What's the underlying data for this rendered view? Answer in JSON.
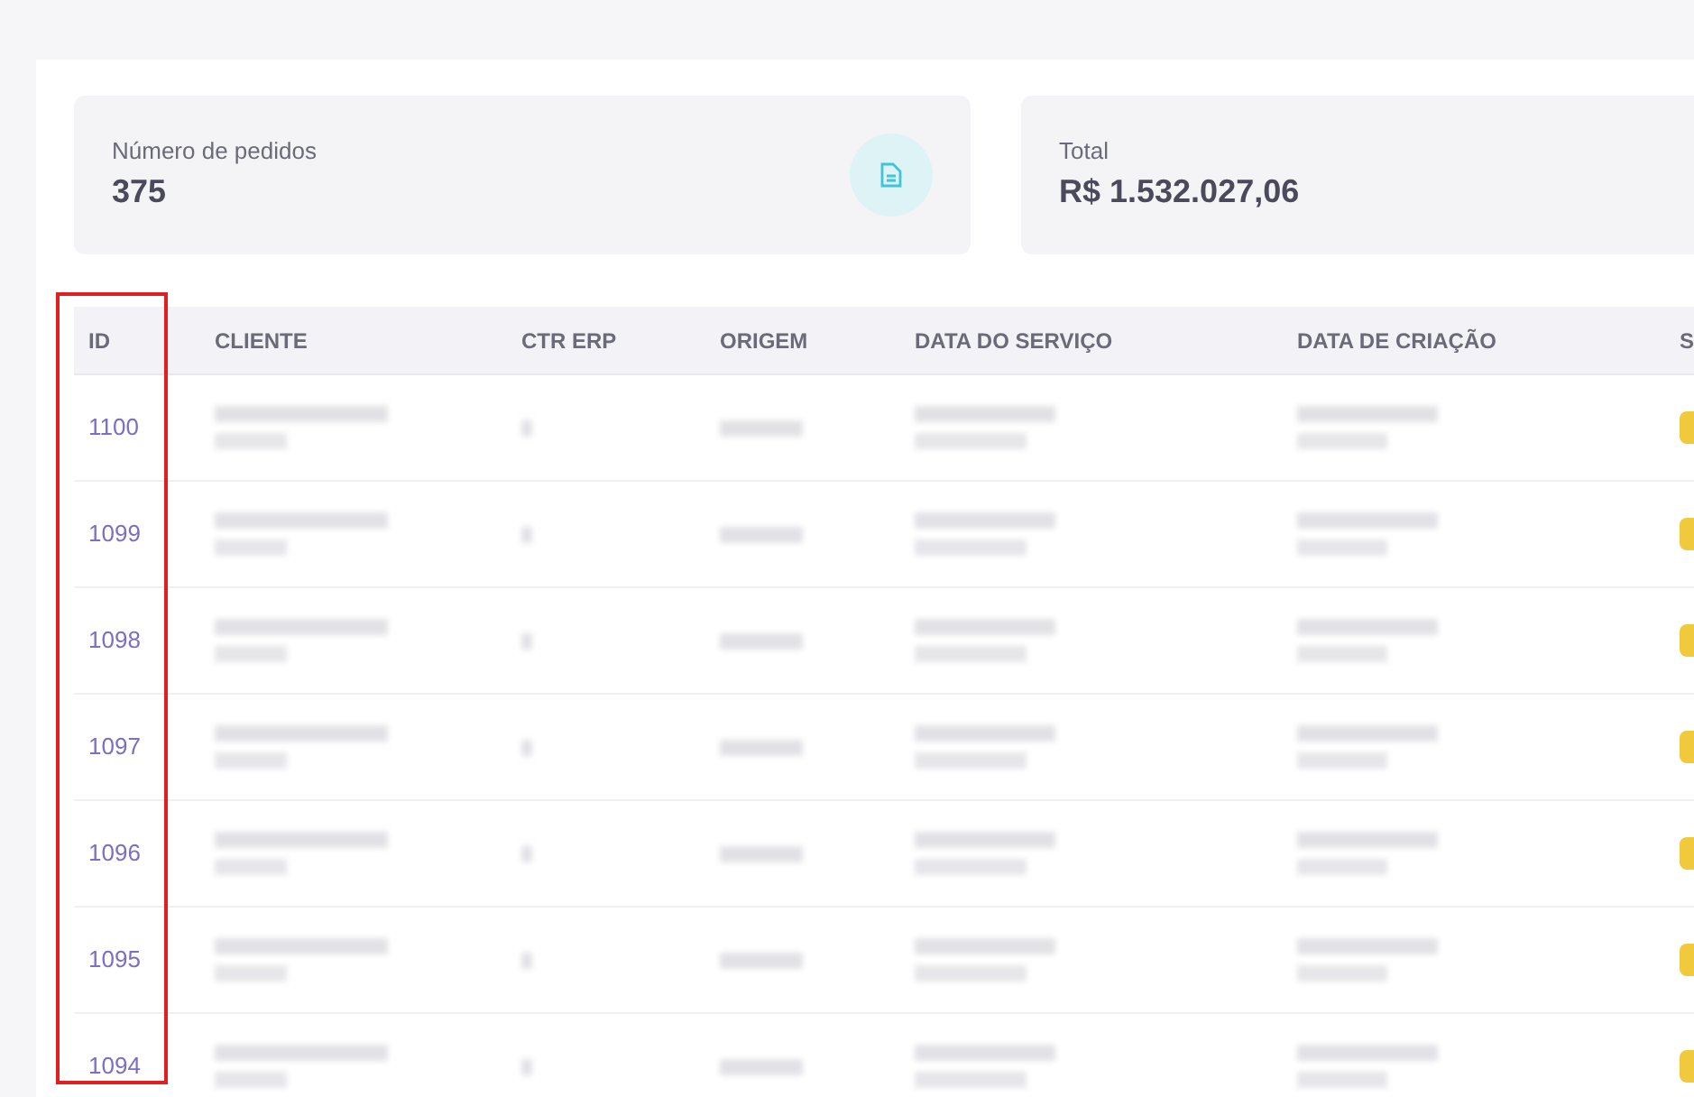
{
  "stats": [
    {
      "label": "Número de pedidos",
      "value": "375",
      "kind": "document"
    },
    {
      "label": "Total",
      "value": "R$ 1.532.027,06",
      "kind": "plain"
    }
  ],
  "table": {
    "columns": [
      "ID",
      "CLIENTE",
      "CTR ERP",
      "ORIGEM",
      "DATA DO SERVIÇO",
      "DATA DE CRIAÇÃO",
      "S"
    ],
    "rows": [
      {
        "id": "1100"
      },
      {
        "id": "1099"
      },
      {
        "id": "1098"
      },
      {
        "id": "1097"
      },
      {
        "id": "1096"
      },
      {
        "id": "1095"
      },
      {
        "id": "1094"
      }
    ]
  },
  "id_column_highlighted": true
}
